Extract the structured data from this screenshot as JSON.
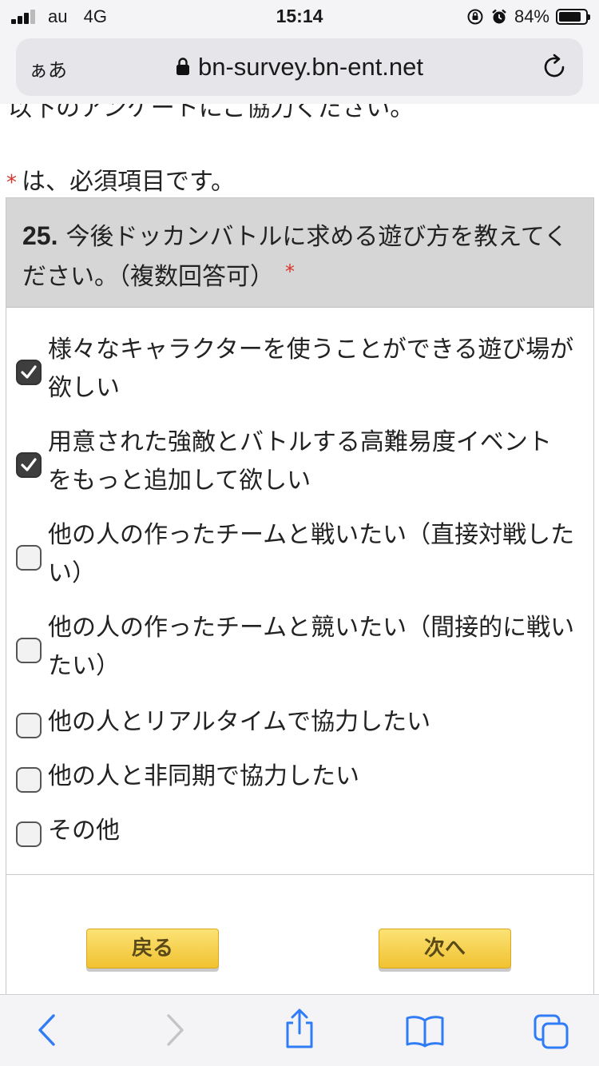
{
  "status_bar": {
    "carrier": "au",
    "network": "4G",
    "time": "15:14",
    "battery_percent": "84%",
    "battery_level": 0.84
  },
  "browser": {
    "text_size_button": "ぁあ",
    "url": "bn-survey.bn-ent.net"
  },
  "page": {
    "intro_text": "以下のアンケートにご協力ください。",
    "required_asterisk": "*",
    "required_note": "は、必須項目です。"
  },
  "question": {
    "number": "25.",
    "text": "今後ドッカンバトルに求める遊び方を教えてください。（複数回答可）",
    "required_asterisk": "*",
    "options": [
      {
        "label": "様々なキャラクターを使うことができる遊び場が欲しい",
        "checked": true
      },
      {
        "label": "用意された強敵とバトルする高難易度イベントをもっと追加して欲しい",
        "checked": true
      },
      {
        "label": "他の人の作ったチームと戦いたい（直接対戦したい）",
        "checked": false
      },
      {
        "label": "他の人の作ったチームと競いたい（間接的に戦いたい）",
        "checked": false
      },
      {
        "label": "他の人とリアルタイムで協力したい",
        "checked": false
      },
      {
        "label": "他の人と非同期で協力したい",
        "checked": false
      },
      {
        "label": "その他",
        "checked": false
      }
    ]
  },
  "buttons": {
    "back": "戻る",
    "next": "次へ"
  },
  "toolbar": {
    "icons": [
      "back-arrow-icon",
      "forward-arrow-icon",
      "share-icon",
      "bookmarks-icon",
      "tabs-icon"
    ]
  },
  "colors": {
    "accent_required": "#d9342b",
    "button_yellow": "#f0c230",
    "header_gray": "#d6d6d6",
    "toolbar_blue": "#2f7cf6"
  }
}
